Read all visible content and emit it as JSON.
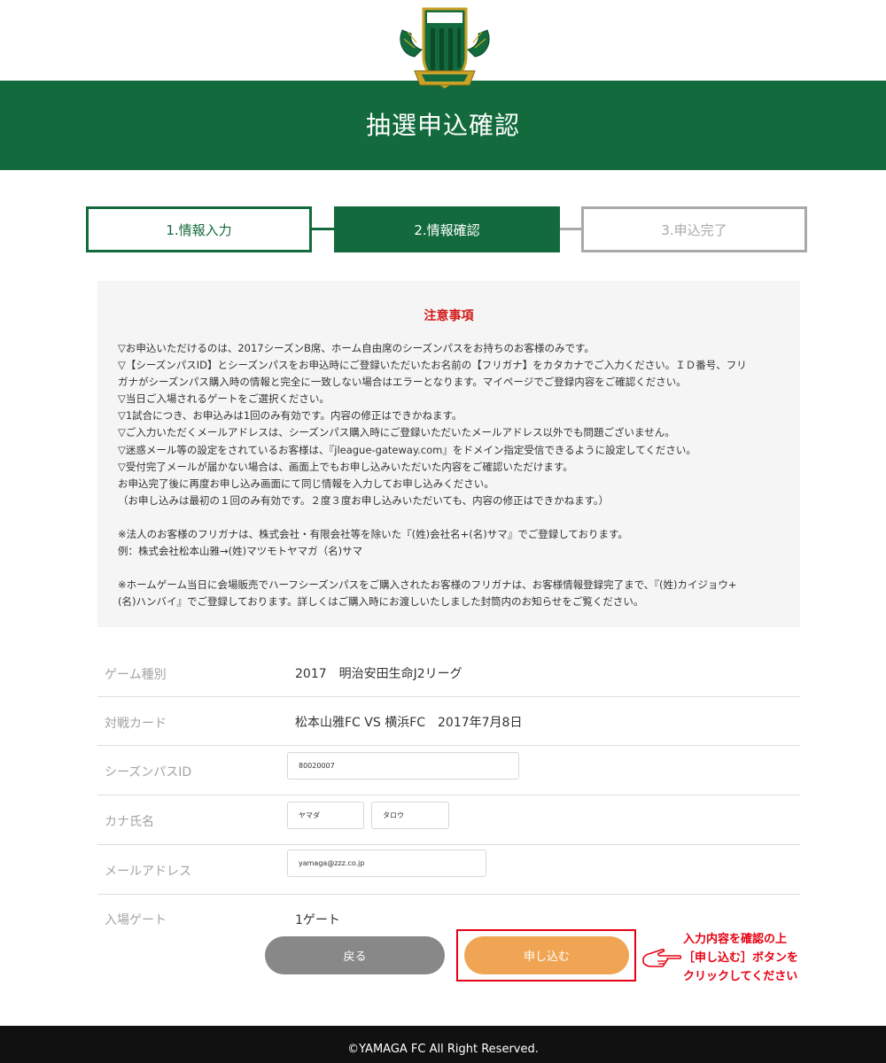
{
  "header": {
    "title": "抽選申込確認",
    "logo_name": "yamaga-fc-crest",
    "brand_color": "#136b3d"
  },
  "steps": [
    {
      "label": "1.情報入力",
      "state": "done"
    },
    {
      "label": "2.情報確認",
      "state": "current"
    },
    {
      "label": "3.申込完了",
      "state": "pending"
    }
  ],
  "notice": {
    "title": "注意事項",
    "lines": [
      "▽お申込いただけるのは、2017シーズンB席、ホーム自由席のシーズンパスをお持ちのお客様のみです。",
      "▽【シーズンパスID】とシーズンパスをお申込時にご登録いただいたお名前の【フリガナ】をカタカナでご入力ください。ＩＤ番号、フリ",
      "ガナがシーズンパス購入時の情報と完全に一致しない場合はエラーとなります。マイページでご登録内容をご確認ください。",
      "▽当日ご入場されるゲートをご選択ください。",
      "▽1試合につき、お申込みは1回のみ有効です。内容の修正はできかねます。",
      "▽ご入力いただくメールアドレスは、シーズンパス購入時にご登録いただいたメールアドレス以外でも問題ございません。",
      "▽迷惑メール等の設定をされているお客様は、『jleague-gateway.com』をドメイン指定受信できるように設定してください。",
      "▽受付完了メールが届かない場合は、画面上でもお申し込みいただいた内容をご確認いただけます。",
      "お申込完了後に再度お申し込み画面にて同じ情報を入力してお申し込みください。",
      "（お申し込みは最初の１回のみ有効です。２度３度お申し込みいただいても、内容の修正はできかねます。）",
      "",
      "※法人のお客様のフリガナは、株式会社・有限会社等を除いた『(姓)会社名+(名)サマ』でご登録しております。",
      "例：株式会社松本山雅→(姓)マツモトヤマガ（名)サマ",
      "",
      "※ホームゲーム当日に会場販売でハーフシーズンパスをご購入されたお客様のフリガナは、お客様情報登録完了まで、『(姓)カイジョウ+",
      "(名)ハンバイ』でご登録しております。詳しくはご購入時にお渡しいたしました封筒内のお知らせをご覧ください。"
    ]
  },
  "form": {
    "game_type": {
      "label": "ゲーム種別",
      "value": "2017　明治安田生命J2リーグ"
    },
    "match_card": {
      "label": "対戦カード",
      "value": "松本山雅FC VS 横浜FC　2017年7月8日"
    },
    "season_pass_id": {
      "label": "シーズンパスID",
      "value": "80020007"
    },
    "kana_name": {
      "label": "カナ氏名",
      "last": "ヤマダ",
      "first": "タロウ"
    },
    "email": {
      "label": "メールアドレス",
      "value": "yamaga@zzz.co.jp"
    },
    "gate": {
      "label": "入場ゲート",
      "value": "1ゲート"
    }
  },
  "buttons": {
    "back": "戻る",
    "apply": "申し込む"
  },
  "annotation": {
    "lines": [
      "入力内容を確認の上",
      "［申し込む］ボタンを",
      "クリックしてください"
    ],
    "color": "#e60012"
  },
  "footer": {
    "copyright": "©YAMAGA FC All Right Reserved."
  }
}
